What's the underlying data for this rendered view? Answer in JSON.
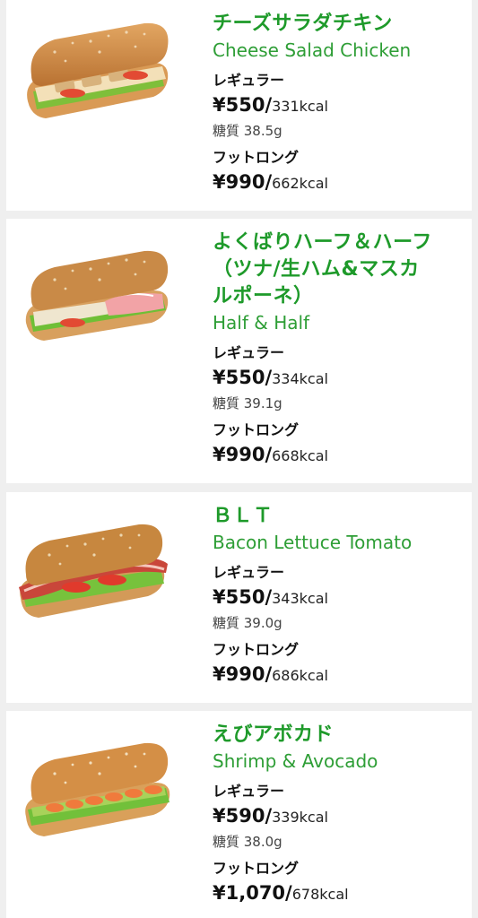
{
  "items": [
    {
      "name_jp": "チーズサラダチキン",
      "name_en": "Cheese Salad Chicken",
      "regular_label": "レギュラー",
      "regular_price": "¥550/",
      "regular_kcal": "331kcal",
      "carb": "糖質 38.5g",
      "footlong_label": "フットロング",
      "footlong_price": "¥990/",
      "footlong_kcal": "662kcal"
    },
    {
      "name_jp_lines": [
        "よくばりハーフ＆ハーフ",
        "（ツナ/生ハム&マスカ",
        "ルポーネ）"
      ],
      "name_en": "Half & Half",
      "regular_label": "レギュラー",
      "regular_price": "¥550/",
      "regular_kcal": "334kcal",
      "carb": "糖質 39.1g",
      "footlong_label": "フットロング",
      "footlong_price": "¥990/",
      "footlong_kcal": "668kcal"
    },
    {
      "name_jp": "ＢＬＴ",
      "name_en": "Bacon Lettuce Tomato",
      "regular_label": "レギュラー",
      "regular_price": "¥550/",
      "regular_kcal": "343kcal",
      "carb": "糖質 39.0g",
      "footlong_label": "フットロング",
      "footlong_price": "¥990/",
      "footlong_kcal": "686kcal"
    },
    {
      "name_jp": "えびアボカド",
      "name_en": "Shrimp & Avocado",
      "regular_label": "レギュラー",
      "regular_price": "¥590/",
      "regular_kcal": "339kcal",
      "carb": "糖質 38.0g",
      "footlong_label": "フットロング",
      "footlong_price": "¥1,070/",
      "footlong_kcal": "678kcal"
    }
  ],
  "colors": {
    "accent_green": "#1e9a2a",
    "background": "#efefef",
    "card": "#ffffff"
  }
}
